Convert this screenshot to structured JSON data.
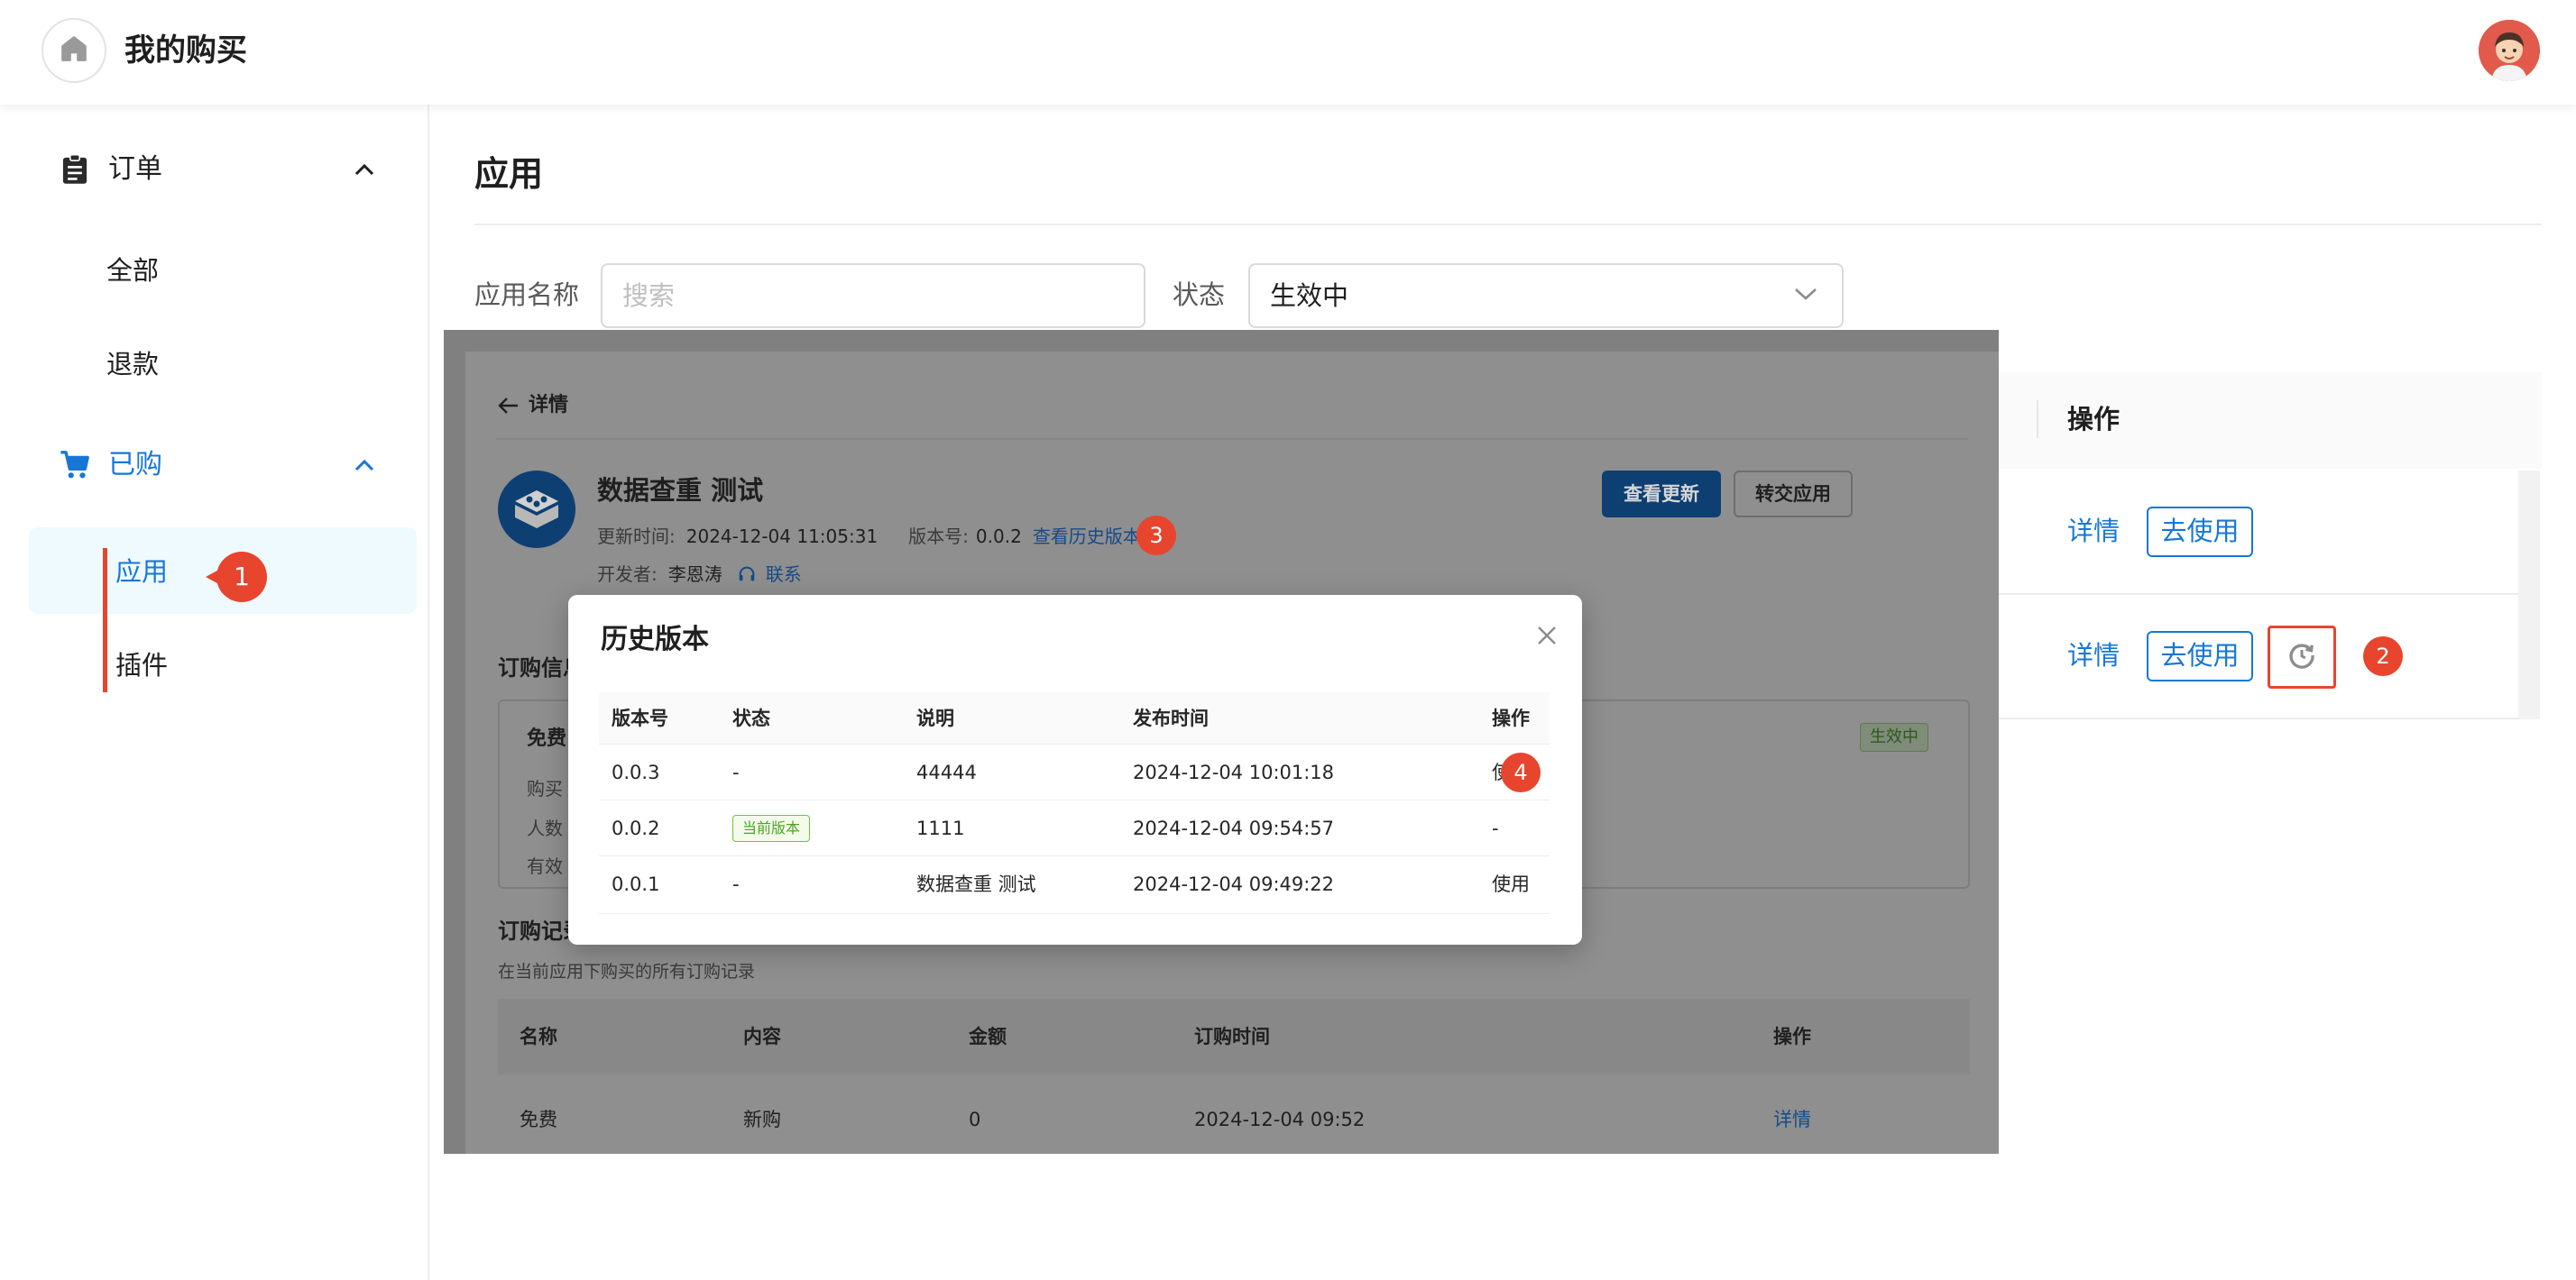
{
  "header": {
    "title": "我的购买",
    "home_icon": "home-icon",
    "avatar_icon": "user-avatar"
  },
  "sidebar": {
    "groups": [
      {
        "label": "订单",
        "icon": "clipboard-icon",
        "items": [
          "全部",
          "退款"
        ]
      },
      {
        "label": "已购",
        "icon": "cart-icon",
        "items": [
          "应用",
          "插件"
        ]
      }
    ],
    "active_item": "应用"
  },
  "main": {
    "title": "应用",
    "filters": {
      "name_label": "应用名称",
      "name_placeholder": "搜索",
      "status_label": "状态",
      "status_value": "生效中"
    },
    "table": {
      "op_header": "操作",
      "rows": [
        {
          "detail": "详情",
          "use": "去使用"
        },
        {
          "detail": "详情",
          "use": "去使用",
          "history_icon": "history-icon"
        }
      ]
    }
  },
  "detail_panel": {
    "back_label": "详情",
    "app_name": "数据查重 测试",
    "update_label": "更新时间:",
    "update_time": "2024-12-04 11:05:31",
    "version_label": "版本号:",
    "version": "0.0.2",
    "history_link": "查看历史版本",
    "developer_label": "开发者:",
    "developer": "李恩涛",
    "contact": "联系",
    "btn_check_update": "查看更新",
    "btn_transfer": "转交应用",
    "purchase_info_title": "订购信息",
    "plan_name": "免费",
    "plan_status": "生效中",
    "info_labels": [
      "购买",
      "人数",
      "有效"
    ],
    "records_title": "订购记录",
    "records_desc": "在当前应用下购买的所有订购记录",
    "records_headers": [
      "名称",
      "内容",
      "金额",
      "订购时间",
      "操作"
    ],
    "records_rows": [
      {
        "name": "免费",
        "content": "新购",
        "amount": "0",
        "time": "2024-12-04 09:52",
        "op": "详情"
      }
    ]
  },
  "modal": {
    "title": "历史版本",
    "headers": [
      "版本号",
      "状态",
      "说明",
      "发布时间",
      "操作"
    ],
    "rows": [
      {
        "version": "0.0.3",
        "status": "-",
        "desc": "44444",
        "time": "2024-12-04 10:01:18",
        "op": "使用"
      },
      {
        "version": "0.0.2",
        "status": "当前版本",
        "desc": "1111",
        "time": "2024-12-04 09:54:57",
        "op": "-"
      },
      {
        "version": "0.0.1",
        "status": "-",
        "desc": "数据查重 测试",
        "time": "2024-12-04 09:49:22",
        "op": "使用"
      }
    ]
  },
  "annotations": [
    "1",
    "2",
    "3",
    "4"
  ],
  "colors": {
    "accent": "#1677d6",
    "marker": "#e8452e",
    "selected_bg": "#eefaff",
    "overlay": "#808080"
  }
}
